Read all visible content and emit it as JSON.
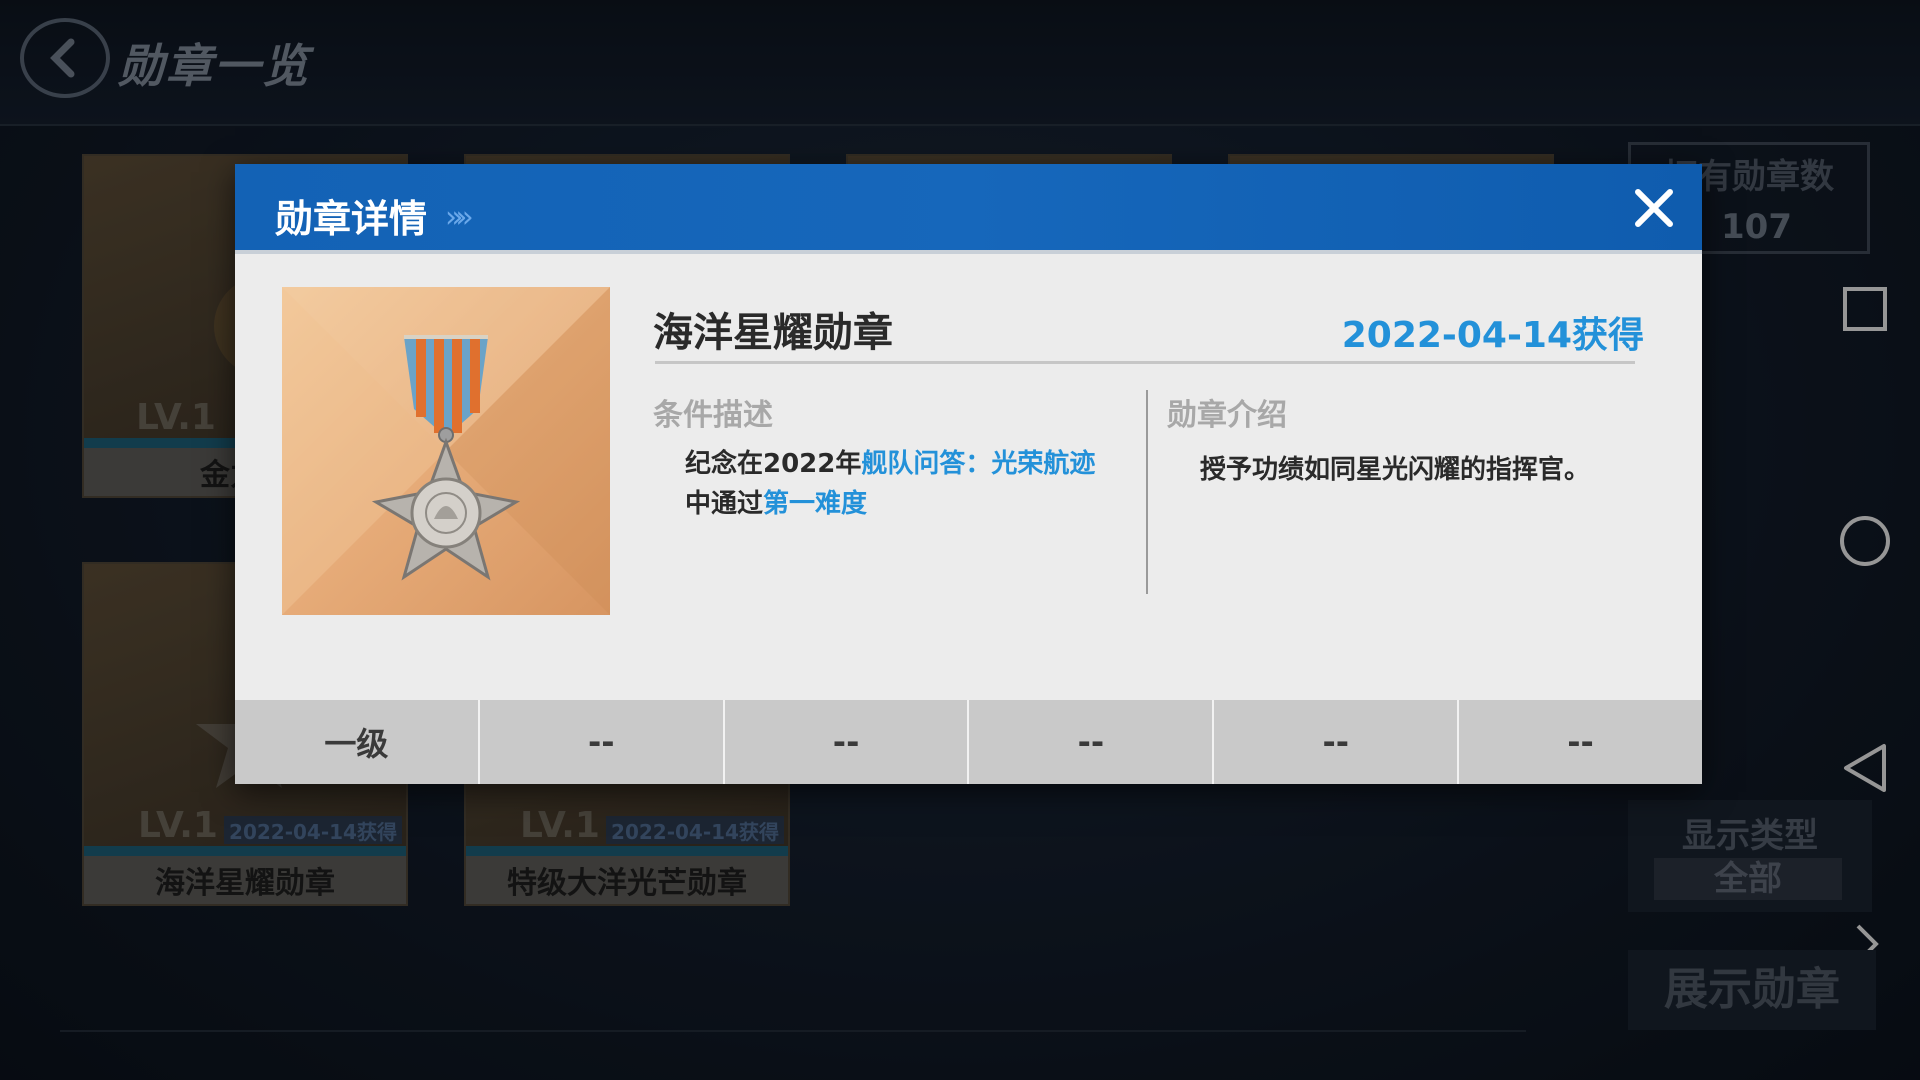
{
  "screen": {
    "title": "勋章一览",
    "owned_label": "拥有勋章数",
    "owned_count": "107",
    "display_type_label": "显示类型",
    "display_type_value": "全部",
    "show_medal_button": "展示勋章"
  },
  "cards": [
    {
      "lv": "LV.1",
      "name": "金力量",
      "date": ""
    },
    {
      "lv": "LV.1",
      "name": "海洋星耀勋章",
      "date": "2022-04-14获得"
    },
    {
      "lv": "LV.1",
      "name": "特级大洋光芒勋章",
      "date": "2022-04-14获得"
    }
  ],
  "dialog": {
    "title": "勋章详情",
    "chevrons": "»»",
    "medal_name": "海洋星耀勋章",
    "obtained_date": "2022-04-14获得",
    "condition_label": "条件描述",
    "condition_parts": {
      "p1": "纪念在2022年",
      "p2": "舰队问答：光荣航迹",
      "p3": "中通过",
      "p4": "第一难度"
    },
    "intro_label": "勋章介绍",
    "intro_text": "授予功绩如同星光闪耀的指挥官。",
    "levels": [
      "一级",
      "--",
      "--",
      "--",
      "--",
      "--"
    ]
  },
  "colors": {
    "header_blue": "#1565b9",
    "highlight_blue": "#2391d9"
  }
}
